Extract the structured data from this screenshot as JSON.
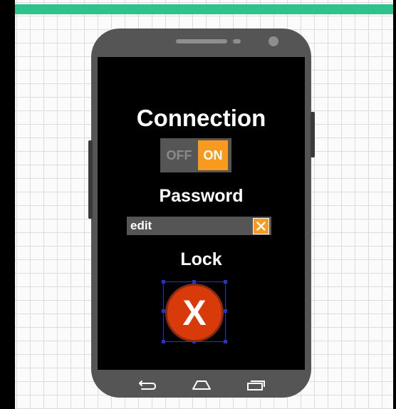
{
  "connection": {
    "title": "Connection",
    "toggle_off_label": "OFF",
    "toggle_on_label": "ON",
    "state": "on"
  },
  "password": {
    "title": "Password",
    "value": "edit"
  },
  "lock": {
    "title": "Lock",
    "button_label": "X"
  },
  "nav": {
    "back_icon": "back-icon",
    "home_icon": "home-icon",
    "recent_icon": "recent-apps-icon"
  },
  "colors": {
    "accent_orange": "#f79a1e",
    "lock_red": "#d93a0a",
    "header_green": "#2fc28c",
    "selection_blue": "#2435c4"
  }
}
